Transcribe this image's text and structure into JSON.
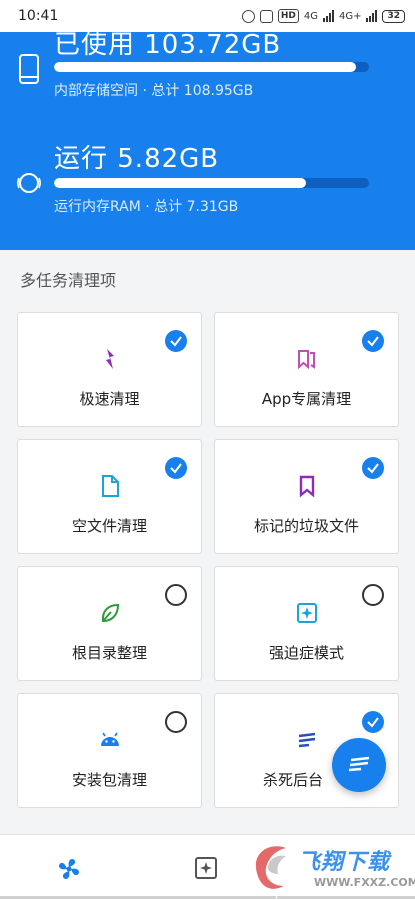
{
  "status_bar": {
    "time": "10:41",
    "hd_label": "HD",
    "net1": "4G",
    "net2": "4G+",
    "battery": "32"
  },
  "storage": {
    "title": "已使用 103.72GB",
    "progress": 0.96,
    "subtitle": "内部存储空间 · 总计 108.95GB"
  },
  "memory": {
    "title": "运行 5.82GB",
    "progress": 0.8,
    "subtitle": "运行内存RAM · 总计 7.31GB"
  },
  "section_title": "多任务清理项",
  "cards": [
    {
      "label": "极速清理",
      "icon": "lightning-icon",
      "checked": true
    },
    {
      "label": "App专属清理",
      "icon": "app-pages-icon",
      "checked": true
    },
    {
      "label": "空文件清理",
      "icon": "file-icon",
      "checked": true
    },
    {
      "label": "标记的垃圾文件",
      "icon": "bookmark-icon",
      "checked": true
    },
    {
      "label": "根目录整理",
      "icon": "leaf-icon",
      "checked": false
    },
    {
      "label": "强迫症模式",
      "icon": "sparkle-icon",
      "checked": false
    },
    {
      "label": "安装包清理",
      "icon": "android-icon",
      "checked": false
    },
    {
      "label": "杀死后台",
      "icon": "lines-icon",
      "checked": true
    }
  ],
  "watermark": {
    "text": "飞翔下载",
    "url": "WWW.FXXZ.COM"
  },
  "colors": {
    "accent": "#1880ec",
    "purple": "#8a2fb5",
    "cyan": "#1aa5d8",
    "green": "#2e9a3c"
  }
}
